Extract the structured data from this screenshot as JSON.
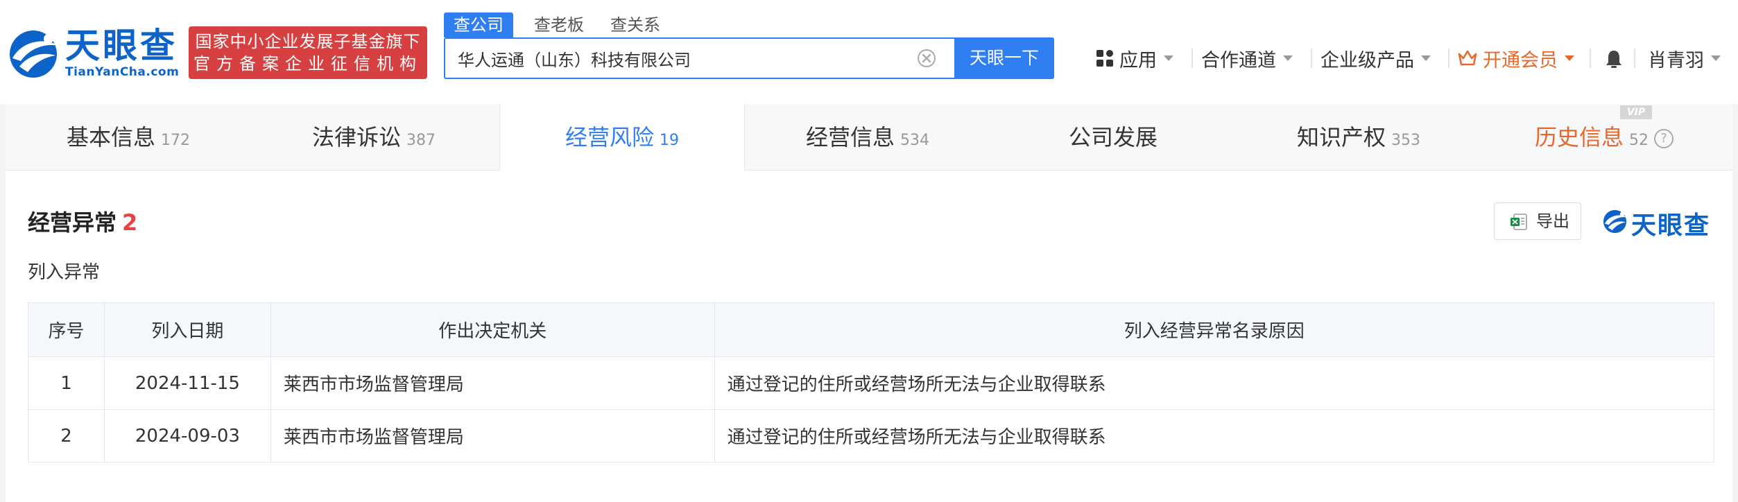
{
  "header": {
    "logo_text": "天眼查",
    "logo_sub": "TianYanCha.com",
    "badge_line1": "国家中小企业发展子基金旗下",
    "badge_line2": "官方备案企业征信机构",
    "search_tabs": [
      "查公司",
      "查老板",
      "查关系"
    ],
    "search_value": "华人运通（山东）科技有限公司",
    "search_button": "天眼一下",
    "nav": {
      "apps": "应用",
      "cooperation": "合作通道",
      "enterprise": "企业级产品",
      "vip": "开通会员",
      "user": "肖青羽"
    }
  },
  "tabs": [
    {
      "label": "基本信息",
      "count": "172"
    },
    {
      "label": "法律诉讼",
      "count": "387"
    },
    {
      "label": "经营风险",
      "count": "19"
    },
    {
      "label": "经营信息",
      "count": "534"
    },
    {
      "label": "公司发展",
      "count": ""
    },
    {
      "label": "知识产权",
      "count": "353"
    },
    {
      "label": "历史信息",
      "count": "52"
    }
  ],
  "vip_badge": "VIP",
  "section": {
    "title": "经营异常",
    "count": "2",
    "subtitle": "列入异常",
    "export_label": "导出",
    "brand_text": "天眼查"
  },
  "table": {
    "headers": [
      "序号",
      "列入日期",
      "作出决定机关",
      "列入经营异常名录原因"
    ],
    "rows": [
      [
        "1",
        "2024-11-15",
        "莱西市市场监督管理局",
        "通过登记的住所或经营场所无法与企业取得联系"
      ],
      [
        "2",
        "2024-09-03",
        "莱西市市场监督管理局",
        "通过登记的住所或经营场所无法与企业取得联系"
      ]
    ]
  },
  "colors": {
    "brand_blue": "#0e63c9",
    "accent_blue": "#2f7ff3",
    "badge_red": "#d64040",
    "history_orange": "#e8672a",
    "count_red": "#e64343"
  }
}
